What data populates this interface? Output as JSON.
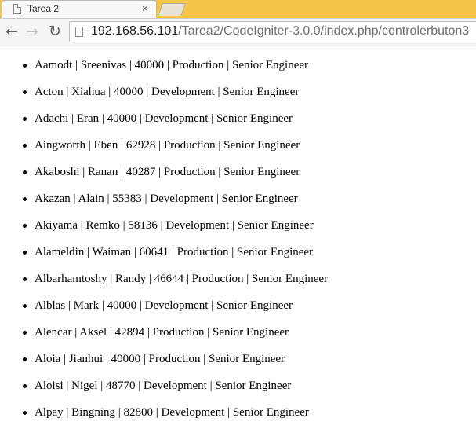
{
  "browser": {
    "tab_title": "Tarea 2",
    "tab_close": "×",
    "url_host": "192.168.56.101",
    "url_path": "/Tarea2/CodeIgniter-3.0.0/index.php/controlerbuton3"
  },
  "employees": [
    "Aamodt | Sreenivas | 40000 | Production | Senior Engineer",
    "Acton | Xiahua | 40000 | Development | Senior Engineer",
    "Adachi | Eran | 40000 | Development | Senior Engineer",
    "Aingworth | Eben | 62928 | Production | Senior Engineer",
    "Akaboshi | Ranan | 40287 | Production | Senior Engineer",
    "Akazan | Alain | 55383 | Development | Senior Engineer",
    "Akiyama | Remko | 58136 | Development | Senior Engineer",
    "Alameldin | Waiman | 60641 | Production | Senior Engineer",
    "Albarhamtoshy | Randy | 46644 | Production | Senior Engineer",
    "Alblas | Mark | 40000 | Development | Senior Engineer",
    "Alencar | Aksel | 42894 | Production | Senior Engineer",
    "Aloia | Jianhui | 40000 | Production | Senior Engineer",
    "Aloisi | Nigel | 48770 | Development | Senior Engineer",
    "Alpay | Bingning | 82800 | Development | Senior Engineer"
  ]
}
